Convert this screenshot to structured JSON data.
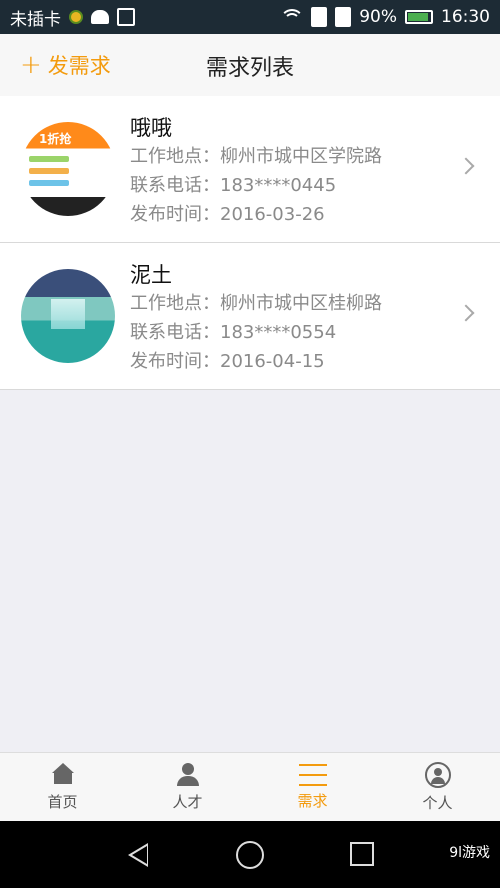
{
  "status_bar": {
    "carrier": "未插卡",
    "battery": "90%",
    "time": "16:30"
  },
  "header": {
    "add_label": "发需求",
    "title": "需求列表"
  },
  "items": [
    {
      "name": "哦哦",
      "location_label": "工作地点：",
      "location": "柳州市城中区学院路",
      "phone_label": "联系电话：",
      "phone": "183****0445",
      "date_label": "发布时间：",
      "date": "2016-03-26"
    },
    {
      "name": "泥土",
      "location_label": "工作地点：",
      "location": "柳州市城中区桂柳路",
      "phone_label": "联系电话：",
      "phone": "183****0554",
      "date_label": "发布时间：",
      "date": "2016-04-15"
    }
  ],
  "tabbar": {
    "tabs": [
      {
        "label": "首页",
        "icon": "home-icon"
      },
      {
        "label": "人才",
        "icon": "person-icon"
      },
      {
        "label": "需求",
        "icon": "menu-icon"
      },
      {
        "label": "个人",
        "icon": "user-icon"
      }
    ],
    "active_tab": "需求",
    "accent_color": "#f39b0e"
  },
  "watermark": "9l游戏"
}
